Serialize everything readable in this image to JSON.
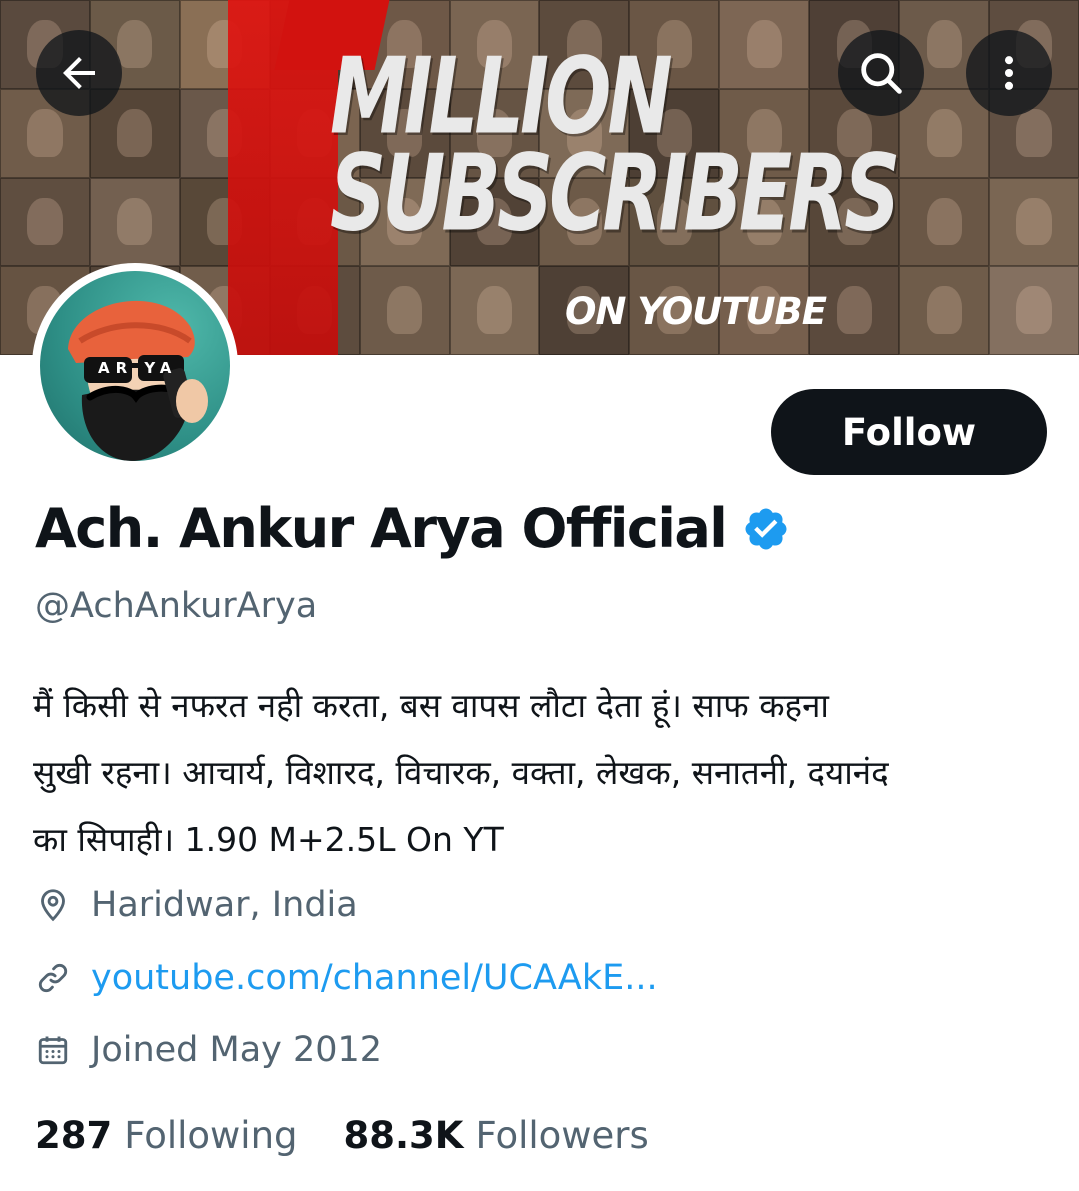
{
  "banner": {
    "title_line1": "MILLION",
    "title_line2": "SUBSCRIBERS",
    "subtitle": "ON YOUTUBE",
    "accent_color": "#e01410",
    "icons": {
      "back": "arrow-left-icon",
      "search": "search-icon",
      "more": "more-vertical-icon"
    }
  },
  "avatar": {
    "badge_text": "AR YA"
  },
  "actions": {
    "follow_label": "Follow"
  },
  "profile": {
    "display_name": "Ach. Ankur Arya Official",
    "verified": true,
    "verified_color": "#1d9bf0",
    "handle": "@AchAnkurArya",
    "bio_line1": "मैं किसी से नफरत नही करता, बस वापस लौटा देता हूं। साफ कहना",
    "bio_line2": "सुखी रहना। आचार्य, विशारद, विचारक, वक्ता, लेखक, सनातनी, दयानंद",
    "bio_line3": "का सिपाही। 1.90 M+2.5L On YT",
    "location": "Haridwar, India",
    "website": "youtube.com/channel/UCAAkE...",
    "joined": "Joined May 2012"
  },
  "stats": {
    "following_count": "287",
    "following_label": "Following",
    "followers_count": "88.3K",
    "followers_label": "Followers"
  }
}
